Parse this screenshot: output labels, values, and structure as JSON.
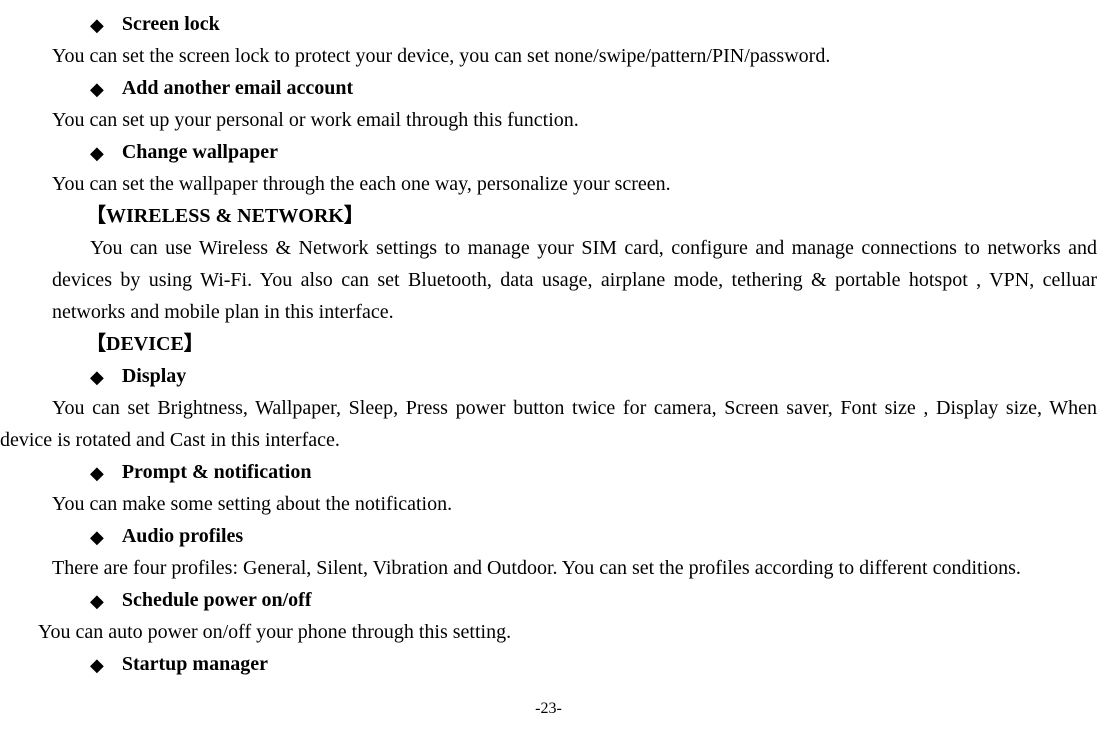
{
  "sections": [
    {
      "bullet": "◆",
      "title": "Screen lock",
      "body": "You can set the screen lock to protect your device, you can set none/swipe/pattern/PIN/password."
    },
    {
      "bullet": "◆",
      "title": "Add another email account",
      "body": "You can set up your personal or work email through this function."
    },
    {
      "bullet": "◆",
      "title": "Change wallpaper",
      "body": "You can set the wallpaper through the each one way, personalize your screen."
    }
  ],
  "wireless": {
    "heading": "【WIRELESS & NETWORK】",
    "body": "You can use Wireless & Network settings to manage your SIM card, configure and manage connections to networks and devices by using Wi-Fi. You also can set Bluetooth, data usage, airplane mode, tethering & portable hotspot , VPN, celluar networks and mobile plan in this interface."
  },
  "device": {
    "heading": "【DEVICE】",
    "items": [
      {
        "bullet": "◆",
        "title": "Display",
        "body": "You can set Brightness, Wallpaper, Sleep, Press power button twice for camera, Screen saver, Font size , Display size, When device is rotated and Cast in this interface.",
        "bodyClass": "body-text",
        "wrap": true
      },
      {
        "bullet": "◆",
        "title": "Prompt & notification",
        "body": "You can make some setting about the notification.",
        "bodyClass": "body-text"
      },
      {
        "bullet": "◆",
        "title": "Audio profiles",
        "body": "There are four profiles: General, Silent, Vibration and Outdoor. You can set the profiles according to different conditions.",
        "bodyClass": "body-text",
        "wrap": true
      },
      {
        "bullet": "◆",
        "title": "Schedule power on/off",
        "body": "You can auto power on/off your phone through this setting.",
        "bodyClass": "body-indent-sm2"
      },
      {
        "bullet": "◆",
        "title": "Startup manager",
        "body": null
      }
    ]
  },
  "page_number": "-23-"
}
